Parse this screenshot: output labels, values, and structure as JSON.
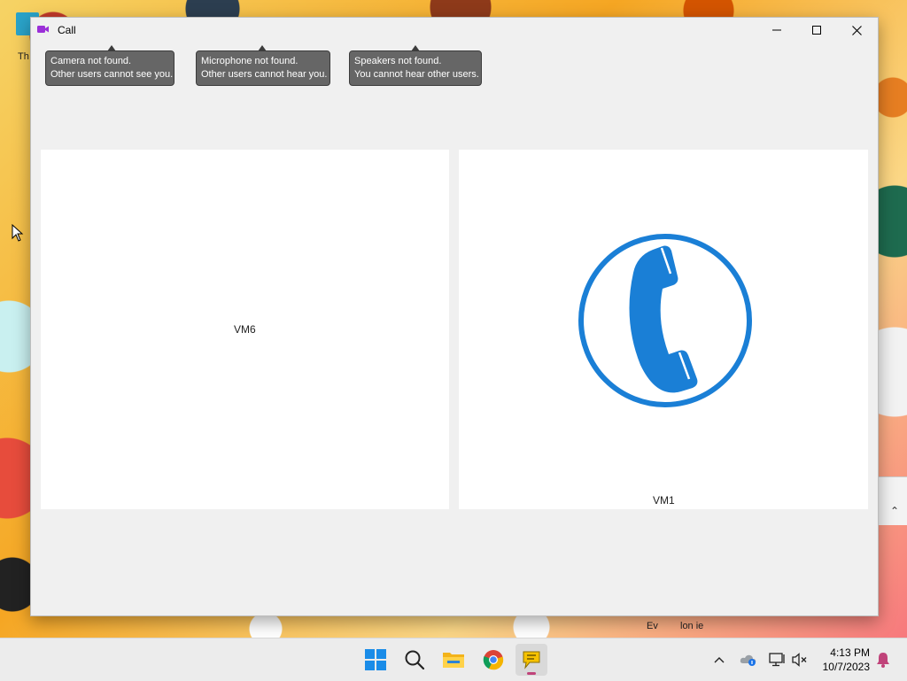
{
  "window": {
    "title": "Call",
    "icon": "video-camera-icon",
    "accent": "#9b2fd8",
    "controls": [
      "minimize-icon",
      "maximize-icon",
      "close-icon"
    ]
  },
  "notifications": [
    {
      "line1": "Camera not found.",
      "line2": "Other users cannot see you."
    },
    {
      "line1": "Microphone not found.",
      "line2": "Other users cannot hear you."
    },
    {
      "line1": "Speakers not found.",
      "line2": "You cannot hear other users."
    }
  ],
  "participants": {
    "local": {
      "name": "VM6"
    },
    "remote": {
      "name": "VM1",
      "icon": "phone-call-icon",
      "icon_color": "#1a7fd6"
    }
  },
  "desktop": {
    "partial_texts": [
      "Th",
      "Ev",
      "lon ie"
    ]
  },
  "taskbar": {
    "apps": [
      "start-icon",
      "search-icon",
      "file-explorer-icon",
      "chrome-icon",
      "chat-app-icon"
    ],
    "tray": [
      "chevron-up-icon",
      "onedrive-icon",
      "network-icon",
      "volume-muted-icon"
    ],
    "time": "4:13 PM",
    "date": "10/7/2023",
    "notification_icon": "bell-icon"
  }
}
